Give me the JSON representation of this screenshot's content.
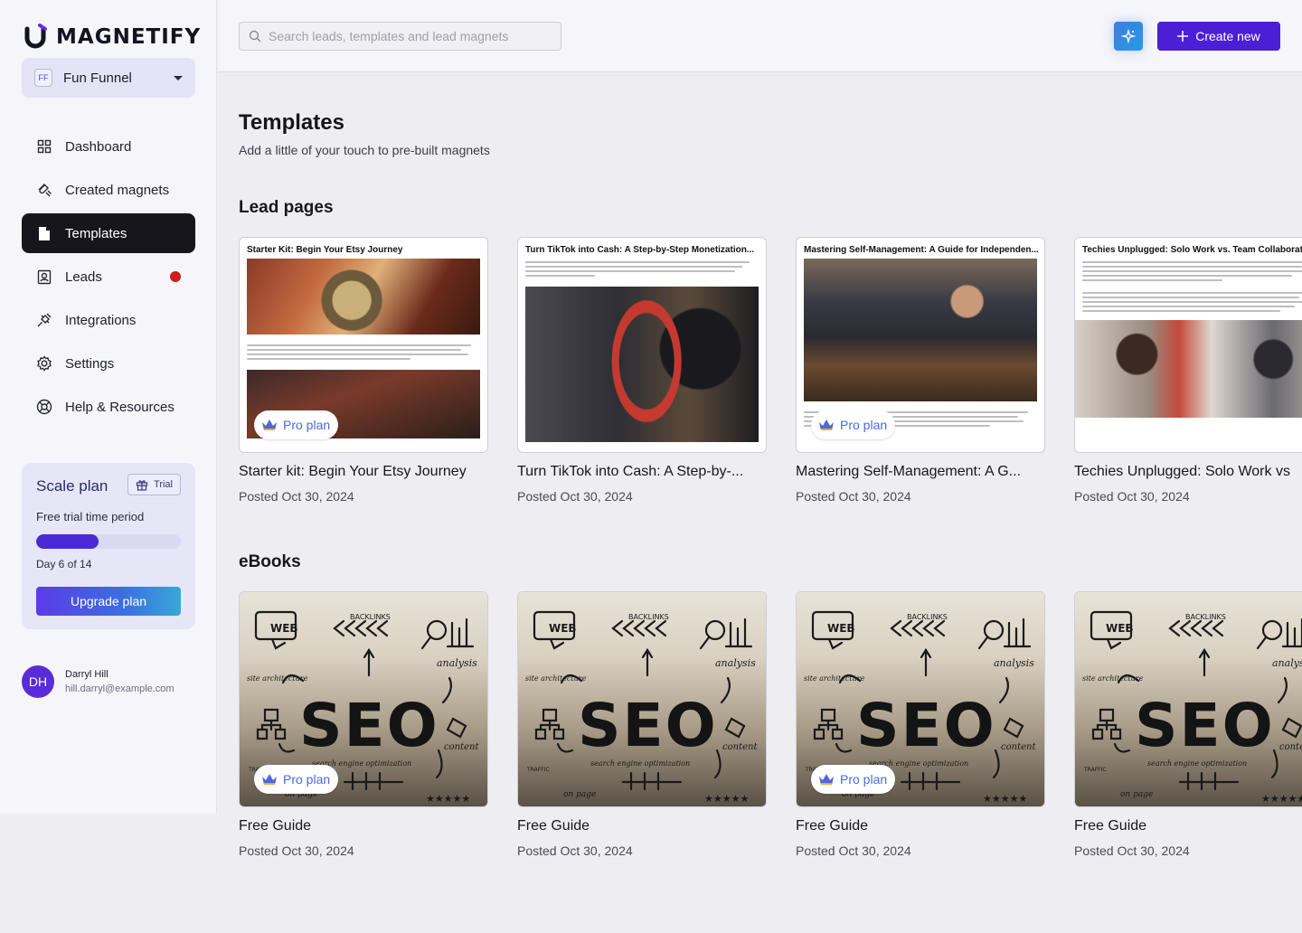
{
  "brand": {
    "logo_text": "MAGNETIFY"
  },
  "workspace": {
    "badge": "FF",
    "name": "Fun Funnel"
  },
  "nav": [
    {
      "id": "dashboard",
      "label": "Dashboard"
    },
    {
      "id": "created",
      "label": "Created magnets"
    },
    {
      "id": "templates",
      "label": "Templates",
      "active": true
    },
    {
      "id": "leads",
      "label": "Leads",
      "has_notification": true
    },
    {
      "id": "integrations",
      "label": "Integrations"
    },
    {
      "id": "settings",
      "label": "Settings"
    },
    {
      "id": "help",
      "label": "Help & Resources"
    }
  ],
  "plan": {
    "title": "Scale plan",
    "badge": "Trial",
    "subtitle": "Free trial time period",
    "progress_fraction": 0.43,
    "day_label": "Day 6 of 14",
    "upgrade_label": "Upgrade plan"
  },
  "user": {
    "initials": "DH",
    "name": "Darryl Hill",
    "email": "hill.darryl@example.com"
  },
  "topbar": {
    "search_placeholder": "Search leads, templates and lead magnets",
    "create_label": "Create new"
  },
  "page": {
    "title": "Templates",
    "subtitle": "Add a little of your touch to pre-built magnets"
  },
  "sections": {
    "lead_pages": {
      "title": "Lead pages",
      "cards": [
        {
          "thumb_title": "Starter Kit: Begin Your Etsy Journey",
          "title": "Starter kit: Begin Your Etsy Journey",
          "date": "Posted Oct 30, 2024",
          "pro": true,
          "badge": "Pro plan"
        },
        {
          "thumb_title": "Turn TikTok into Cash: A Step-by-Step Monetization...",
          "title": "Turn TikTok into Cash: A Step-by-...",
          "date": "Posted Oct 30, 2024",
          "pro": false,
          "badge": ""
        },
        {
          "thumb_title": "Mastering Self-Management: A Guide for Independen...",
          "title": "Mastering Self-Management: A G...",
          "date": "Posted Oct 30, 2024",
          "pro": true,
          "badge": "Pro plan"
        },
        {
          "thumb_title": "Techies Unplugged: Solo Work vs. Team Collaboration",
          "title": "Techies Unplugged: Solo Work vs",
          "date": "Posted Oct 30, 2024",
          "pro": false,
          "badge": ""
        }
      ]
    },
    "ebooks": {
      "title": "eBooks",
      "cards": [
        {
          "title": "Free Guide",
          "date": "Posted Oct 30, 2024",
          "pro": true,
          "badge": "Pro plan"
        },
        {
          "title": "Free Guide",
          "date": "Posted Oct 30, 2024",
          "pro": false,
          "badge": ""
        },
        {
          "title": "Free Guide",
          "date": "Posted Oct 30, 2024",
          "pro": true,
          "badge": "Pro plan"
        },
        {
          "title": "Free Guide",
          "date": "Posted Oct 30, 2024",
          "pro": false,
          "badge": ""
        }
      ],
      "seo_art": {
        "word": "SEO",
        "web": "WEB",
        "backlinks": "BACKLINKS",
        "analysis": "analysis",
        "site": "site architecture",
        "content": "content",
        "search": "search engine optimization",
        "traffic": "TRAFFIC",
        "onpage": "on page"
      }
    }
  },
  "colors": {
    "accent": "#4a1fd6",
    "active_nav": "#16161c",
    "notification": "#c81e1e",
    "pro_text": "#4a6ad8"
  }
}
